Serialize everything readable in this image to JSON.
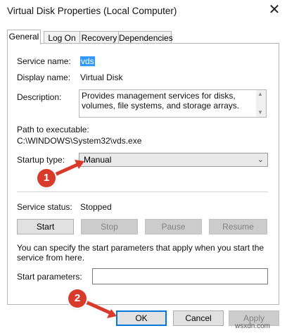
{
  "window": {
    "title": "Virtual Disk Properties (Local Computer)",
    "close_glyph": "✕"
  },
  "tabs": [
    {
      "label": "General",
      "active": true
    },
    {
      "label": "Log On",
      "active": false
    },
    {
      "label": "Recovery",
      "active": false
    },
    {
      "label": "Dependencies",
      "active": false
    }
  ],
  "general": {
    "service_name_label": "Service name:",
    "service_name_value": "vds",
    "display_name_label": "Display name:",
    "display_name_value": "Virtual Disk",
    "description_label": "Description:",
    "description_value": "Provides management services for disks, volumes, file systems, and storage arrays.",
    "path_label": "Path to executable:",
    "path_value": "C:\\WINDOWS\\System32\\vds.exe",
    "startup_type_label": "Startup type:",
    "startup_type_value": "Manual",
    "service_status_label": "Service status:",
    "service_status_value": "Stopped",
    "buttons": {
      "start": "Start",
      "stop": "Stop",
      "pause": "Pause",
      "resume": "Resume"
    },
    "start_params_note": "You can specify the start parameters that apply when you start the service from here.",
    "start_params_label": "Start parameters:",
    "start_params_value": ""
  },
  "footer": {
    "ok": "OK",
    "cancel": "Cancel",
    "apply": "Apply"
  },
  "annotations": [
    {
      "number": "1"
    },
    {
      "number": "2"
    }
  ],
  "watermark": "wsxdn.com",
  "colors": {
    "badge": "#d83b2b",
    "arrow": "#d83b2b",
    "selection": "#3399ff",
    "ok_border": "#0078d7"
  }
}
